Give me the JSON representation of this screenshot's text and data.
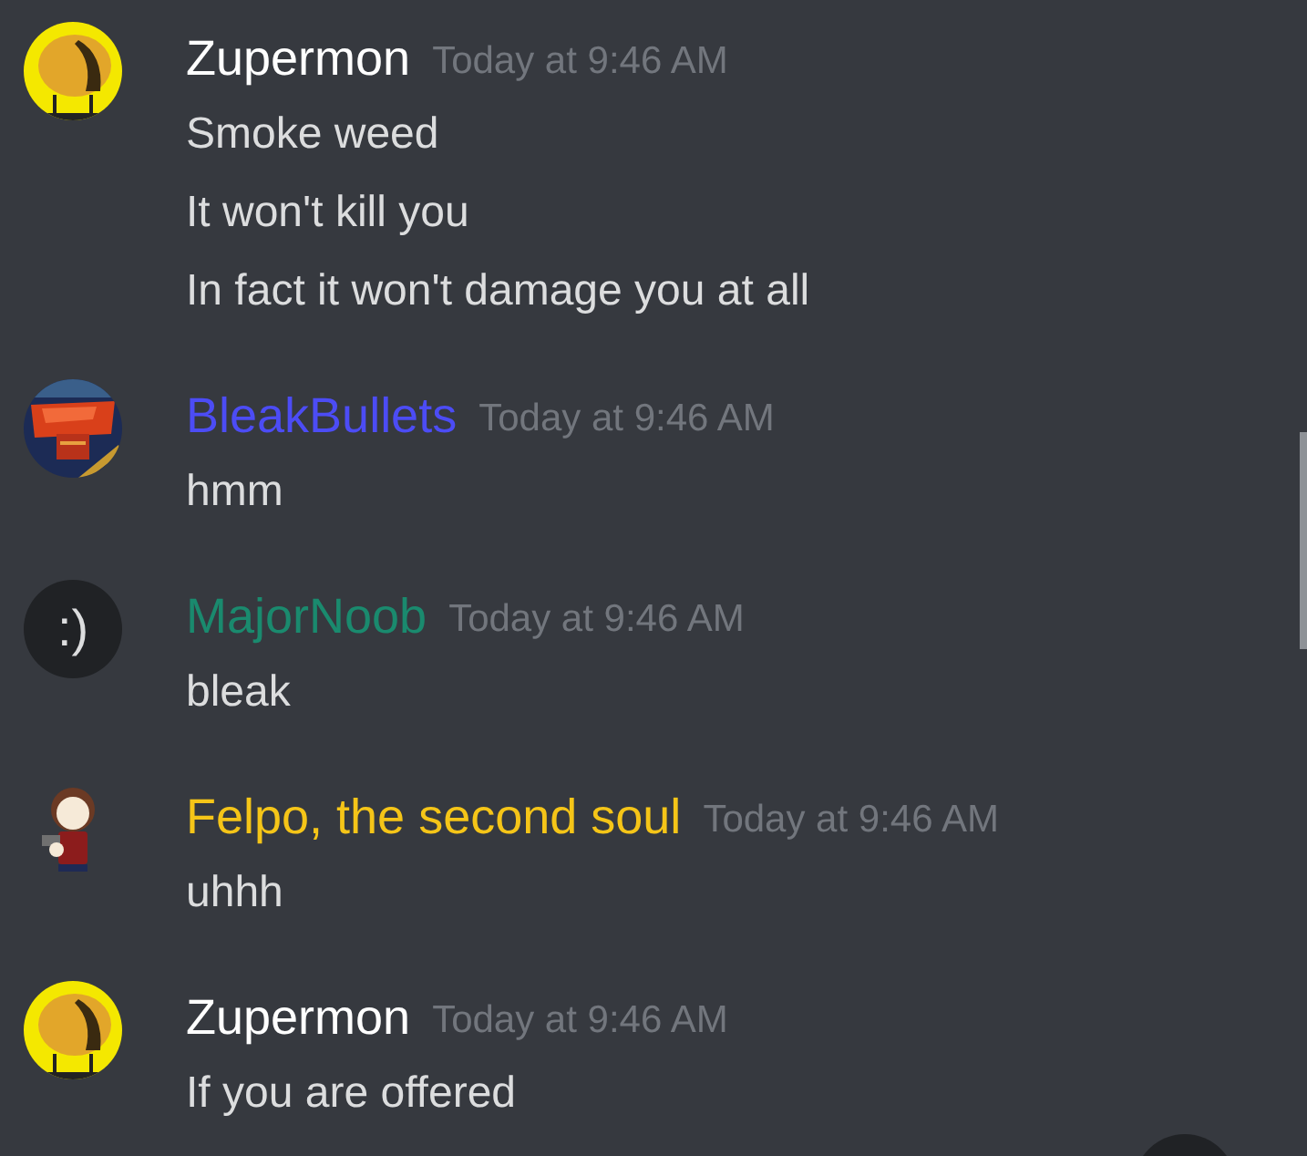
{
  "messages": [
    {
      "author": "Zupermon",
      "color": "#ffffff",
      "timestamp": "Today at 9:46 AM",
      "lines": [
        "Smoke weed",
        "It won't kill you",
        "In fact it won't damage you at all"
      ]
    },
    {
      "author": "BleakBullets",
      "color": "#4c4cf5",
      "timestamp": "Today at 9:46 AM",
      "lines": [
        "hmm"
      ]
    },
    {
      "author": "MajorNoob",
      "color": "#1a8a6e",
      "avatar": {
        "kind": "text",
        "text": ":)"
      },
      "timestamp": "Today at 9:46 AM",
      "lines": [
        "bleak"
      ]
    },
    {
      "author": "Felpo, the second soul",
      "color": "#f5c518",
      "avatar": {
        "kind": "figure"
      },
      "timestamp": "Today at 9:46 AM",
      "lines": [
        "uhhh"
      ]
    },
    {
      "author": "Zupermon",
      "color": "#ffffff",
      "timestamp": "Today at 9:46 AM",
      "lines": [
        "If you are offered"
      ]
    }
  ]
}
